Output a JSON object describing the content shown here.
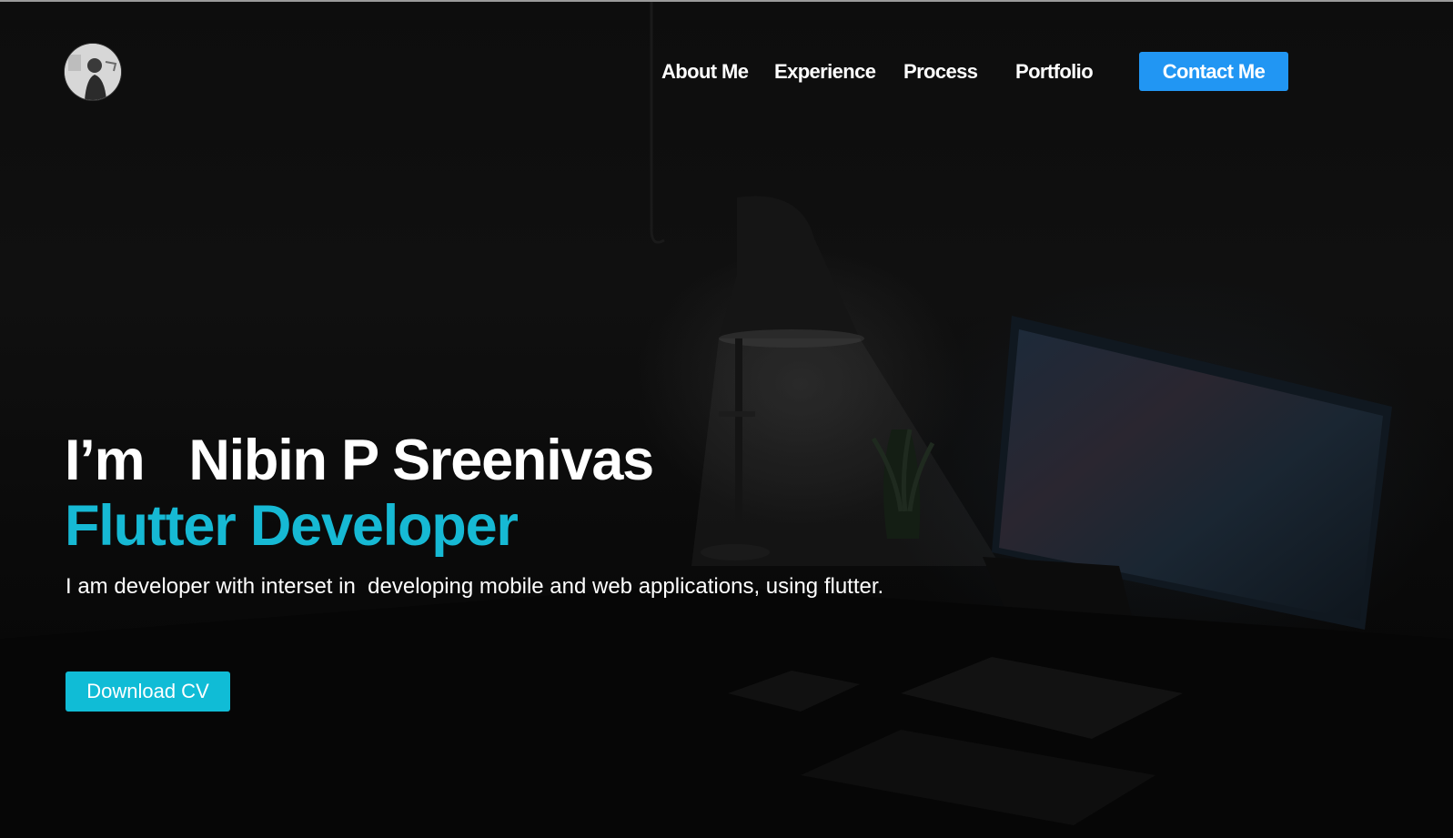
{
  "header": {
    "avatar_alt": "profile-photo",
    "nav": {
      "about": "About Me",
      "experience": "Experience",
      "process": "Process",
      "portfolio": "Portfolio",
      "contact": "Contact Me"
    }
  },
  "hero": {
    "greeting": "I’m   Nibin P Sreenivas",
    "role": "Flutter Developer",
    "description": "I am developer with interset in  developing mobile and web applications, using flutter.",
    "cta": "Download CV"
  },
  "colors": {
    "accent_blue": "#2196f3",
    "accent_cyan": "#16b9d4",
    "button_cyan": "#10bcd6",
    "text": "#ffffff",
    "background": "#070707"
  },
  "background_image": {
    "icon": "desk-lamp-monitor-scene"
  }
}
